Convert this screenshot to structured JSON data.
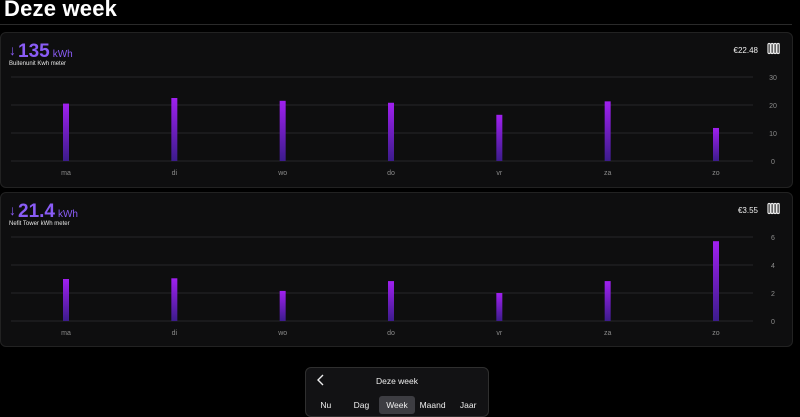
{
  "header": {
    "title": "Deze week"
  },
  "colors": {
    "accent": "#8a5cf6",
    "bar_top": "#a020f0",
    "bar_bottom": "#3c1c8c"
  },
  "cards": [
    {
      "arrow": "↓",
      "value": "135",
      "unit": "kWh",
      "subtitle": "Buitenunit Kwh meter",
      "cost": "€22.48",
      "icon": "radiator-icon"
    },
    {
      "arrow": "↓",
      "value": "21.4",
      "unit": "kWh",
      "subtitle": "Nefit Tower kWh meter",
      "cost": "€3.55",
      "icon": "radiator-icon"
    }
  ],
  "chart_data": [
    {
      "type": "bar",
      "categories": [
        "ma",
        "di",
        "wo",
        "do",
        "vr",
        "za",
        "zo"
      ],
      "values": [
        20.5,
        22.5,
        21.5,
        20.8,
        16.5,
        21.3,
        11.8
      ],
      "yticks": [
        0,
        10,
        20,
        30
      ],
      "ylim": [
        0,
        30
      ],
      "grid": true
    },
    {
      "type": "bar",
      "categories": [
        "ma",
        "di",
        "wo",
        "do",
        "vr",
        "za",
        "zo"
      ],
      "values": [
        3.0,
        3.05,
        2.15,
        2.85,
        2.0,
        2.85,
        5.7
      ],
      "yticks": [
        0,
        2,
        4,
        6
      ],
      "ylim": [
        0,
        6
      ],
      "grid": true
    }
  ],
  "period_nav": {
    "label": "Deze week",
    "tabs": [
      "Nu",
      "Dag",
      "Week",
      "Maand",
      "Jaar"
    ],
    "active_tab": "Week"
  }
}
